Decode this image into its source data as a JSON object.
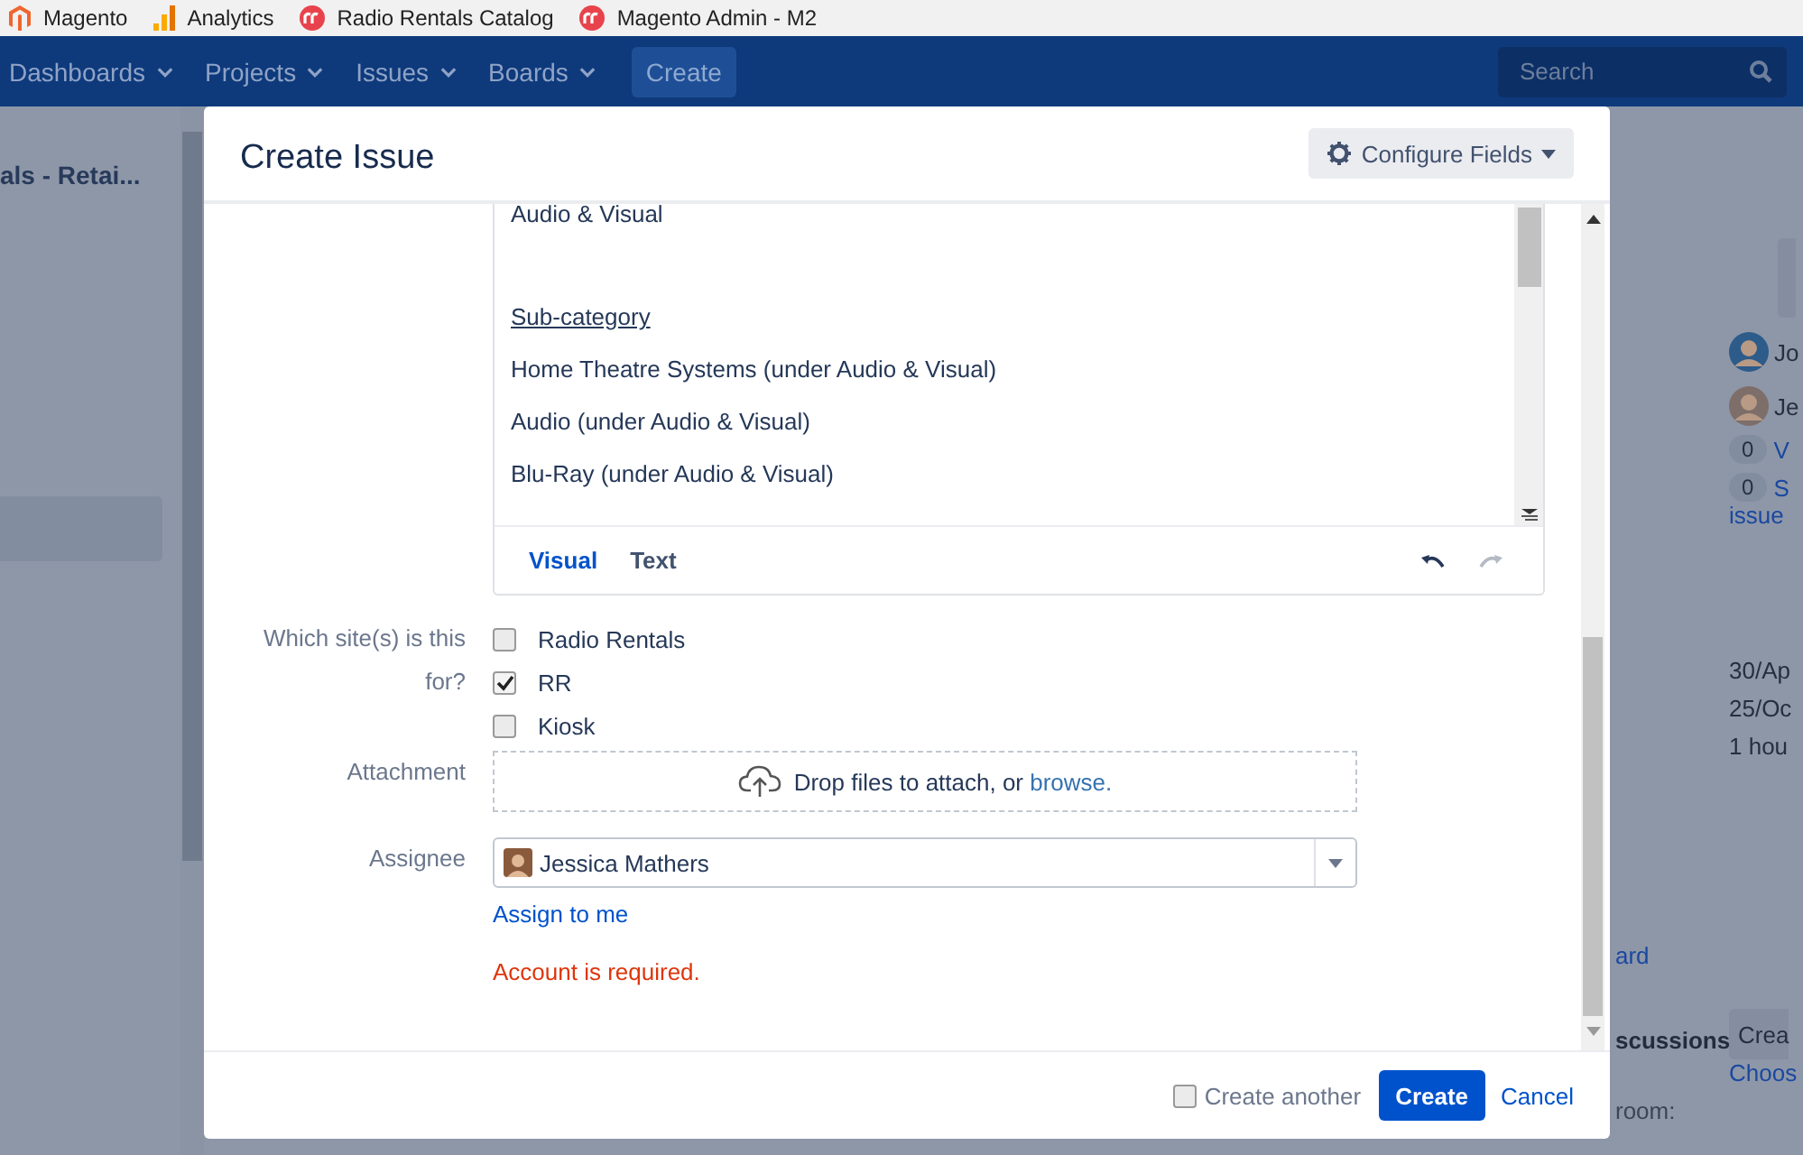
{
  "bookmarks": [
    {
      "kind": "magento",
      "label": "Magento"
    },
    {
      "kind": "analytics",
      "label": "Analytics"
    },
    {
      "kind": "rr",
      "label": "Radio Rentals Catalog"
    },
    {
      "kind": "rr",
      "label": "Magento Admin - M2"
    }
  ],
  "nav": {
    "items": [
      "Dashboards",
      "Projects",
      "Issues",
      "Boards"
    ],
    "create_button": "Create",
    "search": {
      "placeholder": "Search"
    }
  },
  "background": {
    "project_title": "als - Retai...",
    "people": [
      "Jo",
      "Je"
    ],
    "counters": [
      {
        "count": "0",
        "label": "V"
      },
      {
        "count": "0",
        "label": "S"
      }
    ],
    "link_tail": "issue",
    "dates": [
      "30/Ap",
      "25/Oc",
      "1 hou"
    ],
    "board_link": "ard",
    "section_heading": "scussions",
    "room_label": "room:",
    "room_button": "Crea",
    "choose_link": "Choos"
  },
  "dialog": {
    "title": "Create Issue",
    "configure_button": "Configure Fields",
    "editor": {
      "lines": [
        {
          "kind": "plain",
          "text": "Audio & Visual"
        },
        {
          "kind": "heading",
          "text": "Sub-category"
        },
        {
          "kind": "plain",
          "text": "Home Theatre Systems (under Audio & Visual)"
        },
        {
          "kind": "plain",
          "text": "Audio (under Audio & Visual)"
        },
        {
          "kind": "plain",
          "text": "Blu-Ray (under Audio & Visual)"
        }
      ],
      "tabs": [
        {
          "label": "Visual",
          "selected": true
        },
        {
          "label": "Text",
          "selected": false
        }
      ],
      "history": [
        {
          "kind": "undo",
          "disabled": false
        },
        {
          "kind": "redo",
          "disabled": true
        }
      ]
    },
    "sites": {
      "label": "Which site(s) is this for?",
      "options": [
        {
          "label": "Radio Rentals",
          "checked": false
        },
        {
          "label": "RR",
          "checked": true
        },
        {
          "label": "Kiosk",
          "checked": false
        }
      ]
    },
    "attachment": {
      "label": "Attachment",
      "text": "Drop files to attach, or",
      "link": "browse."
    },
    "assignee": {
      "label": "Assignee",
      "value": "Jessica Mathers",
      "assign_link": "Assign to me"
    },
    "error": "Account is required.",
    "footer": {
      "create_another": {
        "label": "Create another",
        "checked": false
      },
      "submit": "Create",
      "cancel": "Cancel"
    }
  }
}
